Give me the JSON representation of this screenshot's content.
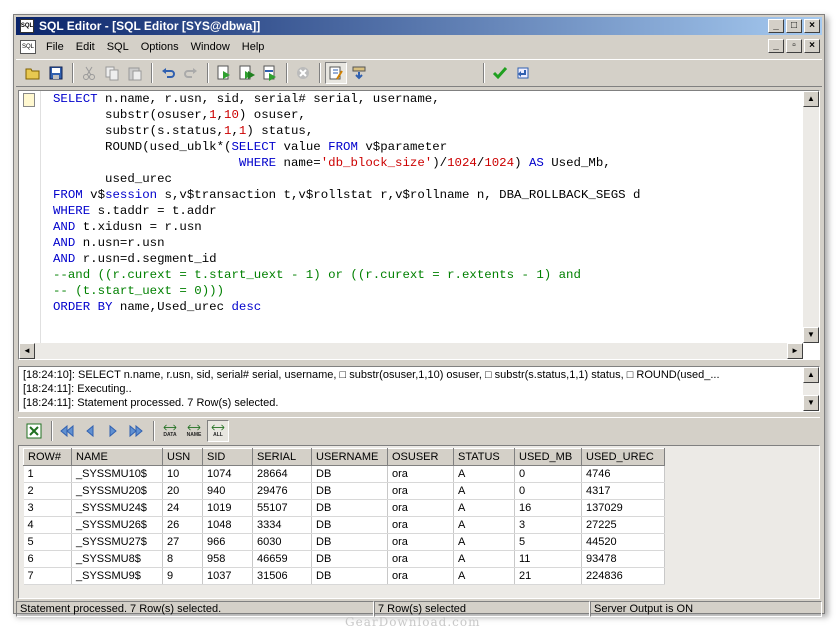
{
  "window": {
    "title": "SQL Editor - [SQL Editor [SYS@dbwa]]",
    "app_icon": "SQL",
    "mdi_icon": "SQL"
  },
  "menu": [
    "File",
    "Edit",
    "SQL",
    "Options",
    "Window",
    "Help"
  ],
  "toolbar_icons": [
    "open-folder-icon",
    "save-icon",
    "cut-icon",
    "copy-icon",
    "paste-icon",
    "undo-icon",
    "redo-icon",
    "execute-icon",
    "execute-script-icon",
    "execute-current-icon",
    "stop-icon",
    "autocommit-icon",
    "explain-icon",
    "commit-icon",
    "rollback-icon"
  ],
  "editor": {
    "lines": [
      [
        [
          "kw",
          "SELECT"
        ],
        [
          "t",
          " n.name, r.usn, sid, serial# serial, username,"
        ]
      ],
      [
        [
          "t",
          "       substr(osuser,"
        ],
        [
          "num",
          "1"
        ],
        [
          "t",
          ","
        ],
        [
          "num",
          "10"
        ],
        [
          "t",
          ") osuser,"
        ]
      ],
      [
        [
          "t",
          "       substr(s.status,"
        ],
        [
          "num",
          "1"
        ],
        [
          "t",
          ","
        ],
        [
          "num",
          "1"
        ],
        [
          "t",
          ") status,"
        ]
      ],
      [
        [
          "t",
          "       ROUND(used_ublk*("
        ],
        [
          "kw",
          "SELECT"
        ],
        [
          "t",
          " value "
        ],
        [
          "kw",
          "FROM"
        ],
        [
          "t",
          " v$parameter"
        ]
      ],
      [
        [
          "t",
          "                         "
        ],
        [
          "kw",
          "WHERE"
        ],
        [
          "t",
          " name="
        ],
        [
          "str",
          "'db_block_size'"
        ],
        [
          "t",
          ")/"
        ],
        [
          "num",
          "1024"
        ],
        [
          "t",
          "/"
        ],
        [
          "num",
          "1024"
        ],
        [
          "t",
          ") "
        ],
        [
          "kw",
          "AS"
        ],
        [
          "t",
          " Used_Mb,"
        ]
      ],
      [
        [
          "t",
          "       used_urec"
        ]
      ],
      [
        [
          "kw",
          "FROM"
        ],
        [
          "t",
          " v$"
        ],
        [
          "kw",
          "session"
        ],
        [
          "t",
          " s,v$transaction t,v$rollstat r,v$rollname n, DBA_ROLLBACK_SEGS d"
        ]
      ],
      [
        [
          "kw",
          "WHERE"
        ],
        [
          "t",
          " s.taddr = t.addr"
        ]
      ],
      [
        [
          "kw",
          "AND"
        ],
        [
          "t",
          " t.xidusn = r.usn"
        ]
      ],
      [
        [
          "kw",
          "AND"
        ],
        [
          "t",
          " n.usn=r.usn"
        ]
      ],
      [
        [
          "kw",
          "AND"
        ],
        [
          "t",
          " r.usn=d.segment_id"
        ]
      ],
      [
        [
          "cmt",
          "--and ((r.curext = t.start_uext - 1) or ((r.curext = r.extents - 1) and"
        ]
      ],
      [
        [
          "cmt",
          "-- (t.start_uext = 0)))"
        ]
      ],
      [
        [
          "kw",
          "ORDER BY"
        ],
        [
          "t",
          " name,Used_urec "
        ],
        [
          "kw",
          "desc"
        ]
      ]
    ]
  },
  "log": {
    "lines": [
      "[18:24:10]: SELECT n.name, r.usn, sid, serial# serial, username, □        substr(osuser,1,10) osuser, □        substr(s.status,1,1) status, □        ROUND(used_...",
      "[18:24:11]: Executing..",
      "[18:24:11]: Statement processed. 7 Row(s) selected."
    ]
  },
  "grid_toolbar": {
    "icons": [
      "excel-export-icon",
      "first-record-icon",
      "prior-record-icon",
      "next-record-icon",
      "last-record-icon"
    ],
    "labels": [
      "DATA",
      "NAME",
      "ALL"
    ]
  },
  "results": {
    "columns": [
      "ROW#",
      "NAME",
      "USN",
      "SID",
      "SERIAL",
      "USERNAME",
      "OSUSER",
      "STATUS",
      "USED_MB",
      "USED_UREC"
    ],
    "rows": [
      [
        "1",
        "_SYSSMU10$",
        "10",
        "1074",
        "28664",
        "DB",
        "ora",
        "A",
        "0",
        "4746"
      ],
      [
        "2",
        "_SYSSMU20$",
        "20",
        "940",
        "29476",
        "DB",
        "ora",
        "A",
        "0",
        "4317"
      ],
      [
        "3",
        "_SYSSMU24$",
        "24",
        "1019",
        "55107",
        "DB",
        "ora",
        "A",
        "16",
        "137029"
      ],
      [
        "4",
        "_SYSSMU26$",
        "26",
        "1048",
        "3334",
        "DB",
        "ora",
        "A",
        "3",
        "27225"
      ],
      [
        "5",
        "_SYSSMU27$",
        "27",
        "966",
        "6030",
        "DB",
        "ora",
        "A",
        "5",
        "44520"
      ],
      [
        "6",
        "_SYSSMU8$",
        "8",
        "958",
        "46659",
        "DB",
        "ora",
        "A",
        "11",
        "93478"
      ],
      [
        "7",
        "_SYSSMU9$",
        "9",
        "1037",
        "31506",
        "DB",
        "ora",
        "A",
        "21",
        "224836"
      ]
    ]
  },
  "status": {
    "message": "Statement processed. 7 Row(s) selected.",
    "rows": "7 Row(s) selected",
    "server_output": "Server Output is ON"
  },
  "watermark": "GearDownload.com"
}
